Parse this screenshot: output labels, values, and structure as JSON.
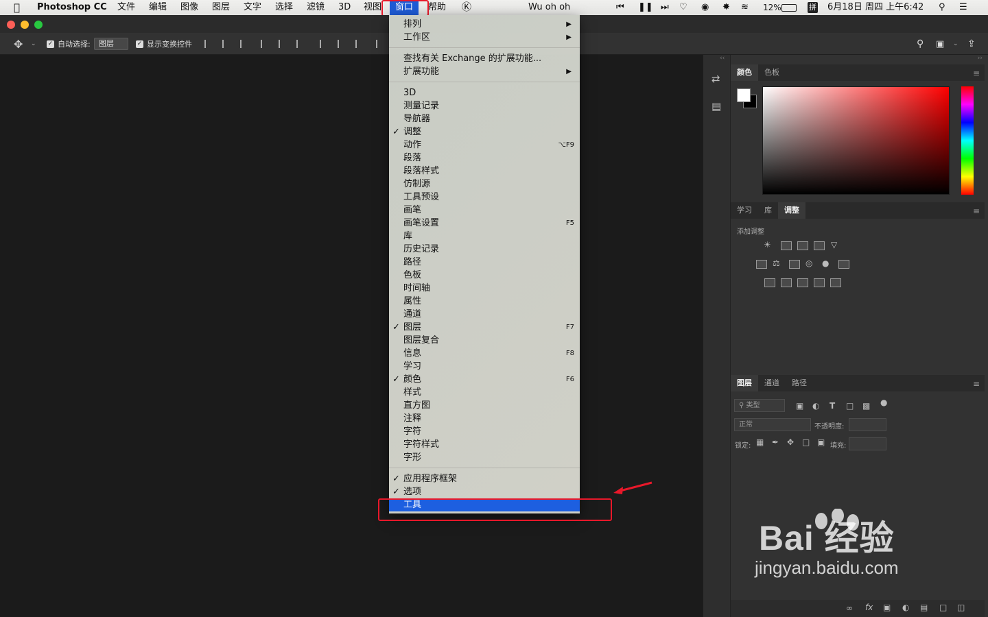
{
  "menubar": {
    "app_name": "Photoshop CC",
    "menus": [
      "文件",
      "编辑",
      "图像",
      "图层",
      "文字",
      "选择",
      "滤镜",
      "3D",
      "视图"
    ],
    "active_menu": "窗口",
    "after_menu": "帮助",
    "track": "Wu oh oh",
    "battery": "12%",
    "input_method": "拼",
    "clock": "6月18日 周四 上午6:42"
  },
  "options_bar": {
    "auto_select_label": "自动选择:",
    "auto_select_value": "图层",
    "show_transform_label": "显示变换控件"
  },
  "window_menu": {
    "items": [
      {
        "label": "排列",
        "submenu": true
      },
      {
        "label": "工作区",
        "submenu": true
      },
      {
        "separator": true
      },
      {
        "label": "查找有关 Exchange 的扩展功能..."
      },
      {
        "label": "扩展功能",
        "submenu": true
      },
      {
        "separator": true
      },
      {
        "label": "3D"
      },
      {
        "label": "测量记录"
      },
      {
        "label": "导航器"
      },
      {
        "label": "调整",
        "checked": true
      },
      {
        "label": "动作",
        "shortcut": "⌥F9"
      },
      {
        "label": "段落"
      },
      {
        "label": "段落样式"
      },
      {
        "label": "仿制源"
      },
      {
        "label": "工具预设"
      },
      {
        "label": "画笔"
      },
      {
        "label": "画笔设置",
        "shortcut": "F5"
      },
      {
        "label": "库"
      },
      {
        "label": "历史记录"
      },
      {
        "label": "路径"
      },
      {
        "label": "色板"
      },
      {
        "label": "时间轴"
      },
      {
        "label": "属性"
      },
      {
        "label": "通道"
      },
      {
        "label": "图层",
        "checked": true,
        "shortcut": "F7"
      },
      {
        "label": "图层复合"
      },
      {
        "label": "信息",
        "shortcut": "F8"
      },
      {
        "label": "学习"
      },
      {
        "label": "颜色",
        "checked": true,
        "shortcut": "F6"
      },
      {
        "label": "样式"
      },
      {
        "label": "直方图"
      },
      {
        "label": "注释"
      },
      {
        "label": "字符"
      },
      {
        "label": "字符样式"
      },
      {
        "label": "字形"
      },
      {
        "separator": true
      },
      {
        "label": "应用程序框架",
        "checked": true
      },
      {
        "label": "选项",
        "checked": true
      },
      {
        "label": "工具",
        "highlighted": true
      }
    ]
  },
  "color_panel": {
    "tabs": [
      "颜色",
      "色板"
    ],
    "active_tab": "颜色"
  },
  "adjustments_panel": {
    "tabs": [
      "学习",
      "库",
      "调整"
    ],
    "active_tab": "调整",
    "title": "添加调整"
  },
  "layers_panel": {
    "tabs": [
      "图层",
      "通道",
      "路径"
    ],
    "active_tab": "图层",
    "filter_placeholder": "类型",
    "blend_mode": "正常",
    "opacity_label": "不透明度:",
    "lock_label": "锁定:",
    "fill_label": "填充:"
  },
  "watermark": {
    "brand": "Bai  经验",
    "url": "jingyan.baidu.com"
  },
  "colors": {
    "menu_highlight": "#1d5fe0",
    "annotation_red": "#e8182a"
  }
}
